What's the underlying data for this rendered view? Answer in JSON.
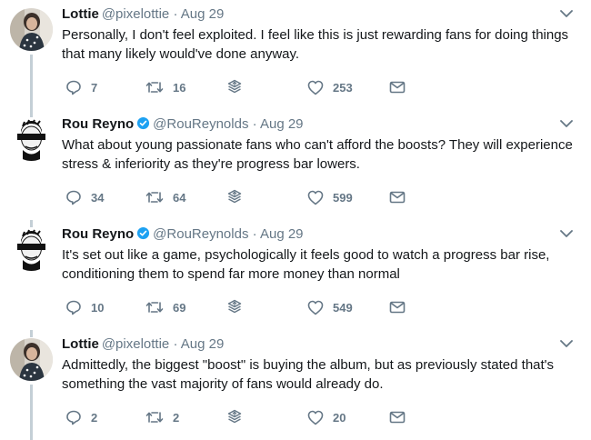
{
  "tweets": [
    {
      "name": "Lottie",
      "verified": false,
      "handle": "@pixelottie",
      "dot": "·",
      "date": "Aug 29",
      "text": "Personally, I don't feel exploited. I feel like this is just rewarding fans for doing things that many likely would've done anyway.",
      "replies": "7",
      "retweets": "16",
      "likes": "253",
      "avatar": "lottie",
      "line_above": false
    },
    {
      "name": "Rou Reyno",
      "verified": true,
      "handle": "@RouReynolds",
      "dot": "·",
      "date": "Aug 29",
      "text": "What about young passionate fans who can't afford the boosts? They will experience stress & inferiority as they're progress bar lowers.",
      "replies": "34",
      "retweets": "64",
      "likes": "599",
      "avatar": "rou",
      "line_above": true
    },
    {
      "name": "Rou Reyno",
      "verified": true,
      "handle": "@RouReynolds",
      "dot": "·",
      "date": "Aug 29",
      "text": "It's set out like a game, psychologically it feels good to watch a progress bar rise, conditioning them to spend far more money than normal",
      "replies": "10",
      "retweets": "69",
      "likes": "549",
      "avatar": "rou",
      "line_above": true
    },
    {
      "name": "Lottie",
      "verified": false,
      "handle": "@pixelottie",
      "dot": "·",
      "date": "Aug 29",
      "text": "Admittedly, the biggest \"boost\" is buying the album, but as previously stated that's something the vast majority of fans would already do.",
      "replies": "2",
      "retweets": "2",
      "likes": "20",
      "avatar": "lottie",
      "line_above": true
    }
  ],
  "colors": {
    "verified": "#1da1f2",
    "icon_gray": "#657786",
    "thread_line": "#c4cfd6",
    "text": "#14171a"
  },
  "icons": [
    "reply-icon",
    "retweet-icon",
    "share-icon",
    "like-icon",
    "direct-message-icon",
    "caret-down-icon",
    "verified-badge-icon"
  ]
}
